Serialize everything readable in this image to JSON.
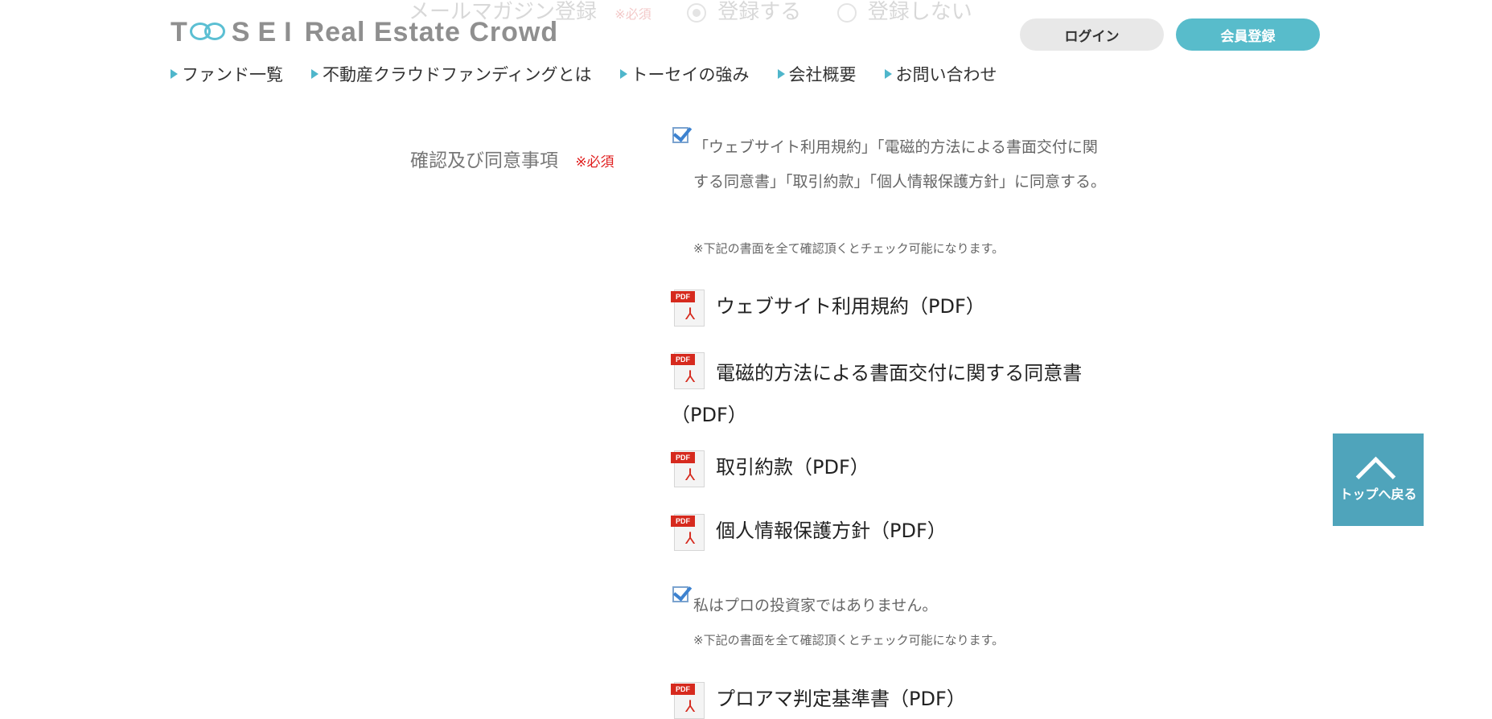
{
  "ghost": {
    "label": "メールマガジン登録",
    "required": "※必須",
    "option_yes": "登録する",
    "option_no": "登録しない"
  },
  "header": {
    "logo": {
      "t": "T",
      "sei": "SEI",
      "rest": "Real Estate Crowd"
    },
    "login": "ログイン",
    "register": "会員登録",
    "nav": [
      "ファンド一覧",
      "不動産クラウドファンディングとは",
      "トーセイの強み",
      "会社概要",
      "お問い合わせ"
    ]
  },
  "form": {
    "label": "確認及び同意事項",
    "required": "※必須",
    "agree_text": "「ウェブサイト利用規約」「電磁的方法による書面交付に関する同意書」「取引約款」「個人情報保護方針」に同意する。",
    "note": "※下記の書面を全て確認頂くとチェック可能になります。",
    "pdf_tag": "PDF",
    "pdf_links": [
      "ウェブサイト利用規約（PDF）",
      "電磁的方法による書面交付に関する同意書（PDF）",
      "取引約款（PDF）",
      "個人情報保護方針（PDF）",
      "プロアマ判定基準書（PDF）"
    ],
    "pro_text": "私はプロの投資家ではありません。",
    "note2": "※下記の書面を全て確認頂くとチェック可能になります。"
  },
  "to_top": "トップへ戻る",
  "colors": {
    "accent": "#58bccb",
    "to_top_bg": "#4fa4bb",
    "required": "#e02020",
    "pdf_red": "#d62a1e"
  }
}
